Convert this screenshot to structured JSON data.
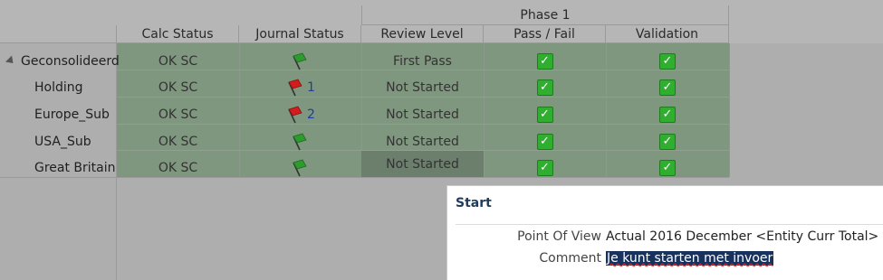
{
  "header": {
    "phase_label": "Phase 1",
    "columns": [
      "Calc Status",
      "Journal Status",
      "Review Level",
      "Pass / Fail",
      "Validation"
    ]
  },
  "rows": [
    {
      "entity": "Geconsolideerd",
      "calc": "OK SC",
      "journal_flag": "green",
      "journal_count": "",
      "review": "First Pass"
    },
    {
      "entity": "Holding",
      "calc": "OK SC",
      "journal_flag": "red",
      "journal_count": "1",
      "review": "Not Started"
    },
    {
      "entity": "Europe_Sub",
      "calc": "OK SC",
      "journal_flag": "red",
      "journal_count": "2",
      "review": "Not Started"
    },
    {
      "entity": "USA_Sub",
      "calc": "OK SC",
      "journal_flag": "green",
      "journal_count": "",
      "review": "Not Started"
    },
    {
      "entity": "Great Britain",
      "calc": "OK SC",
      "journal_flag": "green",
      "journal_count": "",
      "review": "Not Started"
    }
  ],
  "icons": {
    "expander": "collapse-triangle-icon",
    "check": "green-checkbox-icon",
    "flag_green": "green-flag-icon",
    "flag_red": "red-flag-icon"
  },
  "colors": {
    "grid_green": "#7f977f",
    "flag_green": "#2e9b2e",
    "flag_red": "#d21d1d",
    "check_green": "#2fae2f",
    "popup_title": "#1f3b5c",
    "selection": "#17325f"
  },
  "popup": {
    "title": "Start",
    "pov_label": "Point Of View",
    "pov_value": "Actual 2016 December <Entity Curr Total>",
    "comment_label": "Comment",
    "comment_value": "Je kunt starten met invoer"
  }
}
